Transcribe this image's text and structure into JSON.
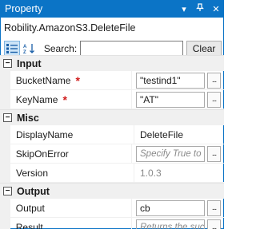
{
  "window": {
    "title": "Property",
    "icons": {
      "pin": "pin-icon",
      "close": "close-icon",
      "menu": "dropdown-icon"
    }
  },
  "object_name": "Robility.AmazonS3.DeleteFile",
  "toolbar": {
    "categorized_icon": "categorized-icon",
    "alphabetical_icon": "alphabetical-sort-icon",
    "search_label": "Search:",
    "search_value": "",
    "clear_label": "Clear"
  },
  "categories": [
    {
      "name": "Input",
      "toggle": "⊟",
      "properties": [
        {
          "name": "BucketName",
          "required": true,
          "value": "\"testind1\"",
          "style": "box",
          "ellipsis": true
        },
        {
          "name": "KeyName",
          "required": true,
          "value": "\"AT\"",
          "style": "box",
          "ellipsis": true
        }
      ]
    },
    {
      "name": "Misc",
      "toggle": "⊟",
      "properties": [
        {
          "name": "DisplayName",
          "required": false,
          "value": "DeleteFile",
          "style": "text",
          "ellipsis": false
        },
        {
          "name": "SkipOnError",
          "required": false,
          "value": "Specify True to ...",
          "style": "placeholder",
          "ellipsis": true
        },
        {
          "name": "Version",
          "required": false,
          "value": "1.0.3",
          "style": "grey",
          "ellipsis": false
        }
      ]
    },
    {
      "name": "Output",
      "toggle": "⊟",
      "properties": [
        {
          "name": "Output",
          "required": false,
          "value": "cb",
          "style": "box",
          "ellipsis": true
        },
        {
          "name": "Result",
          "required": false,
          "value": "Returns the succ...",
          "style": "placeholder",
          "ellipsis": true
        }
      ]
    }
  ],
  "colors": {
    "titlebar": "#0b74c6",
    "required": "#d01c1c",
    "category_bg": "#f0f0f0"
  }
}
